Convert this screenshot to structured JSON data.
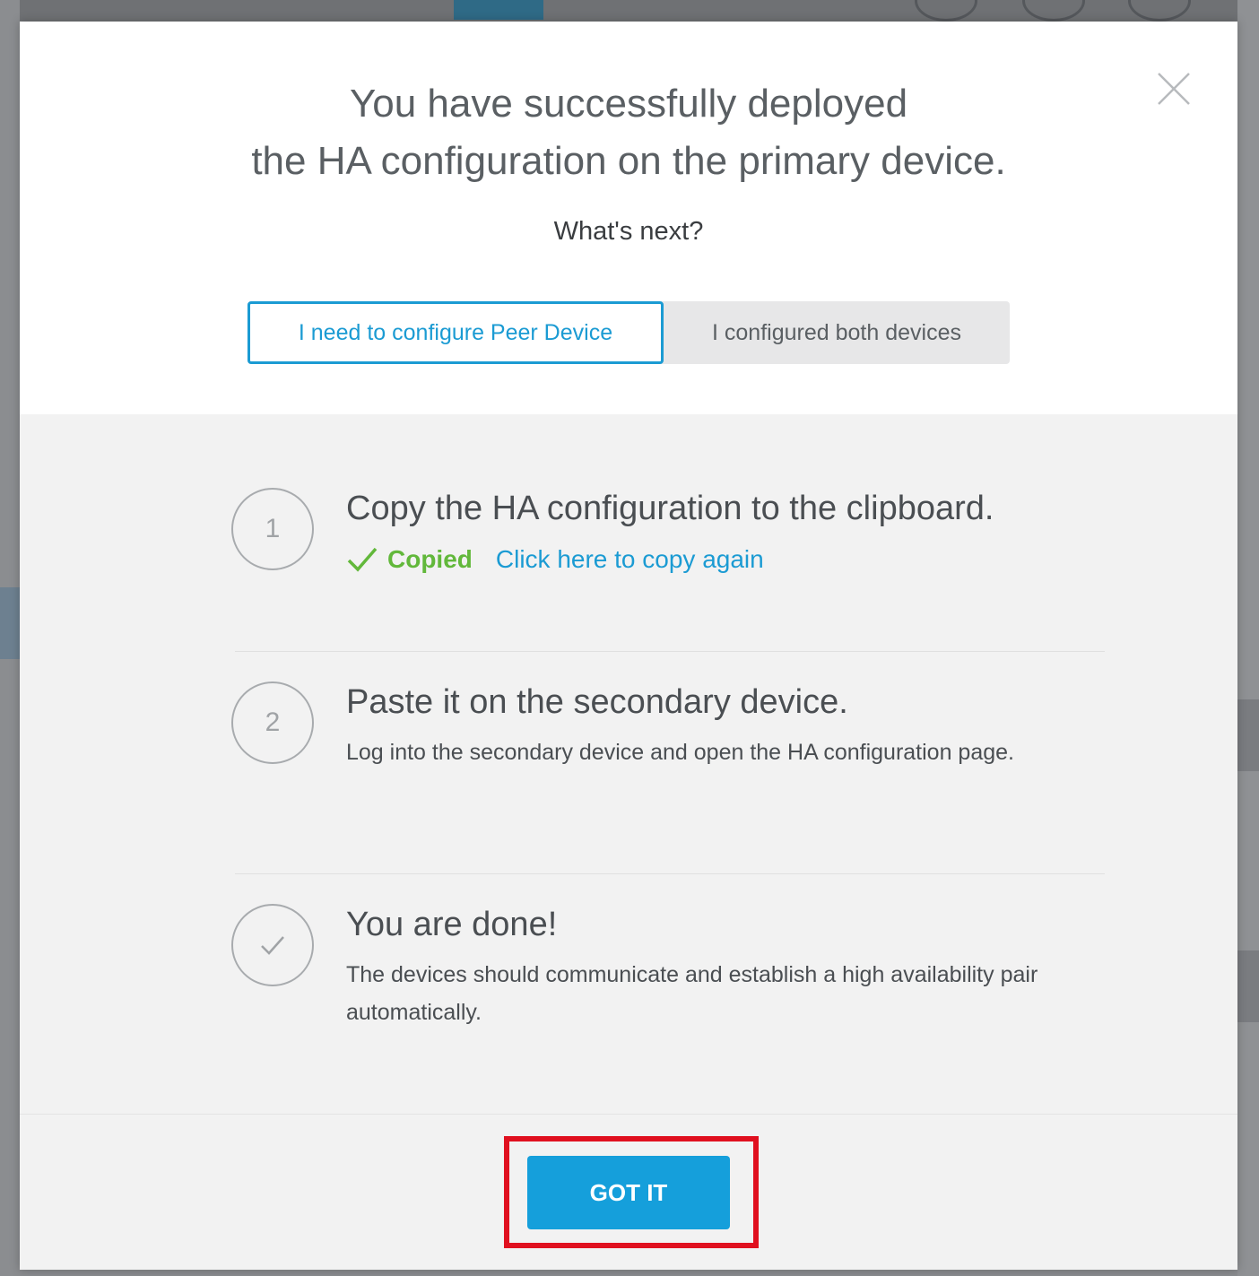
{
  "dialog": {
    "title_line1": "You have successfully deployed",
    "title_line2": "the HA configuration on the primary device.",
    "subtitle": "What's next?",
    "segments": [
      {
        "label": "I need to configure Peer Device",
        "active": true
      },
      {
        "label": "I configured both devices",
        "active": false
      }
    ],
    "close_icon": "close-icon"
  },
  "steps": [
    {
      "number": "1",
      "title": "Copy the HA configuration to the clipboard.",
      "status_label": "Copied",
      "status_icon": "check-icon",
      "link_label": "Click here to copy again"
    },
    {
      "number": "2",
      "title": "Paste it on the secondary device.",
      "description": "Log into the secondary device and open the HA configuration page."
    },
    {
      "icon": "check-icon",
      "title": "You are done!",
      "description": "The devices should communicate and establish a high availability pair automatically."
    }
  ],
  "footer": {
    "confirm_label": "GOT IT"
  },
  "colors": {
    "accent": "#1b9bd3",
    "success": "#62b83b",
    "highlight": "#e0101f",
    "button": "#159fdb"
  }
}
